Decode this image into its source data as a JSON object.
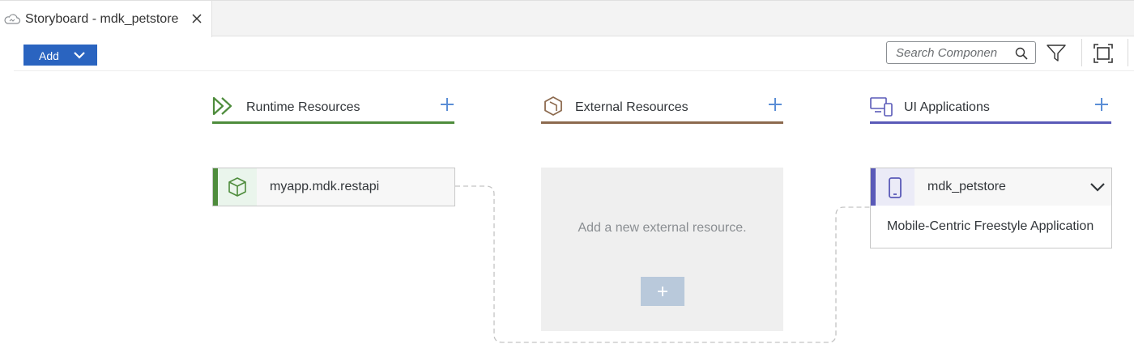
{
  "tab": {
    "title": "Storyboard - mdk_petstore"
  },
  "toolbar": {
    "add_label": "Add",
    "search_placeholder": "Search Componen"
  },
  "columns": [
    {
      "title": "Runtime Resources",
      "color": "#4e8c3c"
    },
    {
      "title": "External Resources",
      "color": "#8c6a4e"
    },
    {
      "title": "UI Applications",
      "color": "#5a5ab8"
    }
  ],
  "runtime_card": {
    "name": "myapp.mdk.restapi"
  },
  "external_placeholder": {
    "message": "Add a new external resource."
  },
  "ui_card": {
    "name": "mdk_petstore",
    "subtitle": "Mobile-Centric Freestyle Application"
  },
  "colors": {
    "accent_blue": "#2a64c0",
    "plus_blue": "#5b8ed6"
  }
}
